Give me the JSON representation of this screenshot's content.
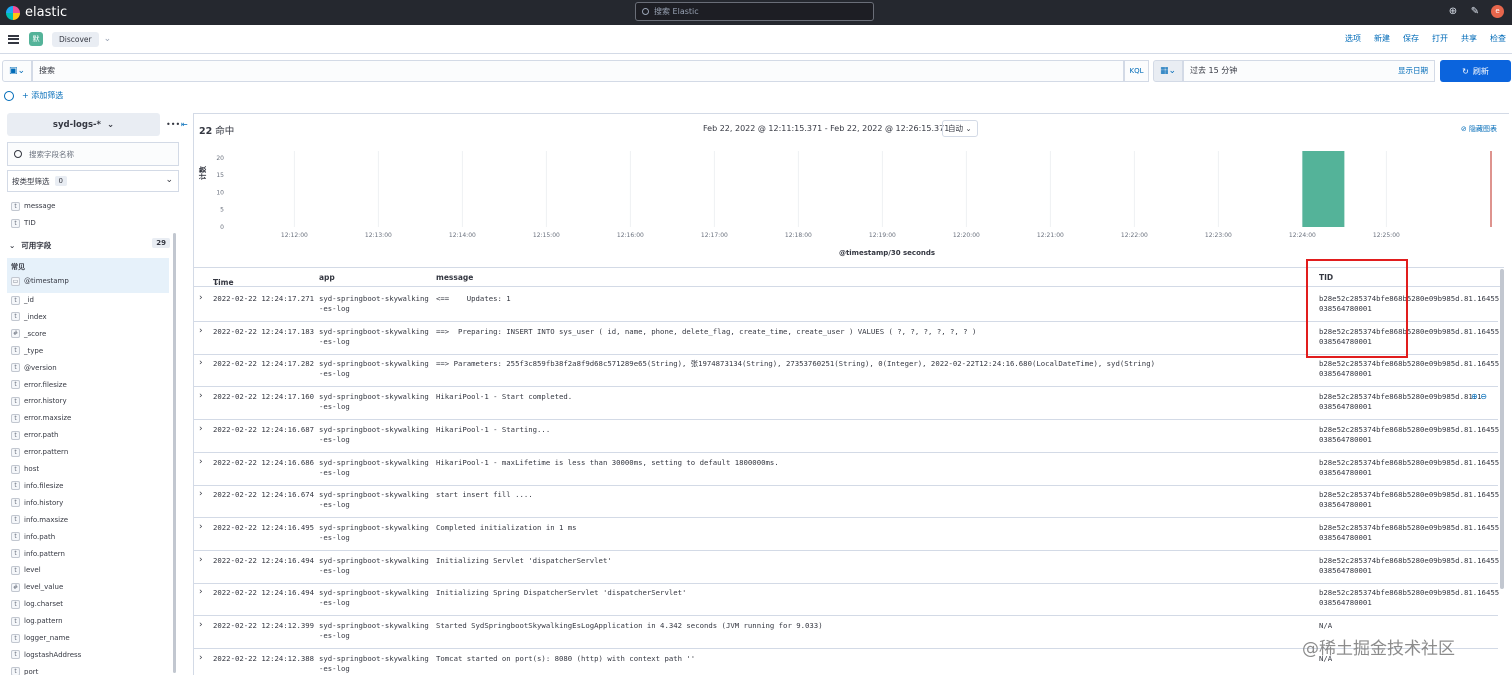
{
  "topbar": {
    "brand": "elastic",
    "search_placeholder": "搜索 Elastic",
    "avatar_letter": "e"
  },
  "header": {
    "app_badge": "默",
    "breadcrumb": "Discover",
    "links": [
      "选项",
      "新建",
      "保存",
      "打开",
      "共享",
      "检查"
    ]
  },
  "query": {
    "placeholder": "搜索",
    "kql": "KQL",
    "time_range": "过去 15 分钟",
    "show_dates": "显示日期",
    "refresh": "刷新"
  },
  "filter": {
    "add_label": "+ 添加筛选"
  },
  "sidebar": {
    "index_pattern": "syd-logs-*",
    "field_search_placeholder": "搜索字段名称",
    "type_filter_label": "按类型筛选",
    "type_filter_count": "0",
    "selected_fields": [
      {
        "type": "t",
        "name": "message"
      },
      {
        "type": "t",
        "name": "TID"
      }
    ],
    "available_label": "可用字段",
    "available_count": "29",
    "popular_label": "常见",
    "popular_fields": [
      {
        "type": "▭",
        "name": "@timestamp"
      }
    ],
    "fields": [
      {
        "type": "t",
        "name": "_id"
      },
      {
        "type": "t",
        "name": "_index"
      },
      {
        "type": "#",
        "name": "_score"
      },
      {
        "type": "t",
        "name": "_type"
      },
      {
        "type": "t",
        "name": "@version"
      },
      {
        "type": "t",
        "name": "error.filesize"
      },
      {
        "type": "t",
        "name": "error.history"
      },
      {
        "type": "t",
        "name": "error.maxsize"
      },
      {
        "type": "t",
        "name": "error.path"
      },
      {
        "type": "t",
        "name": "error.pattern"
      },
      {
        "type": "t",
        "name": "host"
      },
      {
        "type": "t",
        "name": "info.filesize"
      },
      {
        "type": "t",
        "name": "info.history"
      },
      {
        "type": "t",
        "name": "info.maxsize"
      },
      {
        "type": "t",
        "name": "info.path"
      },
      {
        "type": "t",
        "name": "info.pattern"
      },
      {
        "type": "t",
        "name": "level"
      },
      {
        "type": "#",
        "name": "level_value"
      },
      {
        "type": "t",
        "name": "log.charset"
      },
      {
        "type": "t",
        "name": "log.pattern"
      },
      {
        "type": "t",
        "name": "logger_name"
      },
      {
        "type": "t",
        "name": "logstashAddress"
      },
      {
        "type": "t",
        "name": "port"
      }
    ]
  },
  "main": {
    "hits_count": "22",
    "hits_label": "命中",
    "range": "Feb 22, 2022 @ 12:11:15.371 - Feb 22, 2022 @ 12:26:15.371",
    "interval": "自动",
    "hide_chart": "隐藏图表"
  },
  "chart_data": {
    "type": "bar",
    "xlabel": "@timestamp/30 seconds",
    "ylabel": "计数",
    "x_ticks": [
      "12:12:00",
      "12:13:00",
      "12:14:00",
      "12:15:00",
      "12:16:00",
      "12:17:00",
      "12:18:00",
      "12:19:00",
      "12:20:00",
      "12:21:00",
      "12:22:00",
      "12:23:00",
      "12:24:00",
      "12:25:00"
    ],
    "y_ticks": [
      0,
      5,
      10,
      15,
      20
    ],
    "ylim": [
      0,
      22
    ],
    "x_range_minutes": [
      11.2574,
      26.2574
    ],
    "bars": [
      {
        "start_minute": 24.0,
        "end_minute": 24.5,
        "count": 22
      }
    ],
    "bar_color": "#54b399",
    "now_marker_minute": 26.2574,
    "now_marker_color": "#bd271e",
    "grid": true
  },
  "grid": {
    "columns": [
      "Time",
      "app",
      "message",
      "TID"
    ],
    "rows": [
      {
        "time": "2022-02-22 12:24:17.271",
        "app": "syd-springboot-skywalking\n-es-log",
        "message": "<==    Updates: 1",
        "tid": "b28e52c285374bfe868b5280e09b985d.81.16455\n038564780001"
      },
      {
        "time": "2022-02-22 12:24:17.183",
        "app": "syd-springboot-skywalking\n-es-log",
        "message": "==>  Preparing: INSERT INTO sys_user ( id, name, phone, delete_flag, create_time, create_user ) VALUES ( ?, ?, ?, ?, ?, ? )",
        "tid": "b28e52c285374bfe868b5280e09b985d.81.16455\n038564780001"
      },
      {
        "time": "2022-02-22 12:24:17.282",
        "app": "syd-springboot-skywalking\n-es-log",
        "message": "==> Parameters: 255f3c859fb38f2a8f9d68c571289e65(String), 张1974873134(String), 27353760251(String), 0(Integer), 2022-02-22T12:24:16.680(LocalDateTime), syd(String)",
        "tid": "b28e52c285374bfe868b5280e09b985d.81.16455\n038564780001"
      },
      {
        "time": "2022-02-22 12:24:17.160",
        "app": "syd-springboot-skywalking\n-es-log",
        "message": "HikariPool-1 - Start completed.",
        "tid": "b28e52c285374bfe868b5280e09b985d.81.1\n038564780001"
      },
      {
        "time": "2022-02-22 12:24:16.687",
        "app": "syd-springboot-skywalking\n-es-log",
        "message": "HikariPool-1 - Starting...",
        "tid": "b28e52c285374bfe868b5280e09b985d.81.16455\n038564780001"
      },
      {
        "time": "2022-02-22 12:24:16.686",
        "app": "syd-springboot-skywalking\n-es-log",
        "message": "HikariPool-1 - maxLifetime is less than 30000ms, setting to default 1800000ms.",
        "tid": "b28e52c285374bfe868b5280e09b985d.81.16455\n038564780001"
      },
      {
        "time": "2022-02-22 12:24:16.674",
        "app": "syd-springboot-skywalking\n-es-log",
        "message": "start insert fill ....",
        "tid": "b28e52c285374bfe868b5280e09b985d.81.16455\n038564780001"
      },
      {
        "time": "2022-02-22 12:24:16.495",
        "app": "syd-springboot-skywalking\n-es-log",
        "message": "Completed initialization in 1 ms",
        "tid": "b28e52c285374bfe868b5280e09b985d.81.16455\n038564780001"
      },
      {
        "time": "2022-02-22 12:24:16.494",
        "app": "syd-springboot-skywalking\n-es-log",
        "message": "Initializing Servlet 'dispatcherServlet'",
        "tid": "b28e52c285374bfe868b5280e09b985d.81.16455\n038564780001"
      },
      {
        "time": "2022-02-22 12:24:16.494",
        "app": "syd-springboot-skywalking\n-es-log",
        "message": "Initializing Spring DispatcherServlet 'dispatcherServlet'",
        "tid": "b28e52c285374bfe868b5280e09b985d.81.16455\n038564780001"
      },
      {
        "time": "2022-02-22 12:24:12.399",
        "app": "syd-springboot-skywalking\n-es-log",
        "message": "Started SydSpringbootSkywalkingEsLogApplication in 4.342 seconds (JVM running for 9.033)",
        "tid": "N/A"
      },
      {
        "time": "2022-02-22 12:24:12.388",
        "app": "syd-springboot-skywalking\n-es-log",
        "message": "Tomcat started on port(s): 8080 (http) with context path ''",
        "tid": "N/A"
      }
    ]
  },
  "watermark": "@稀土掘金技术社区"
}
